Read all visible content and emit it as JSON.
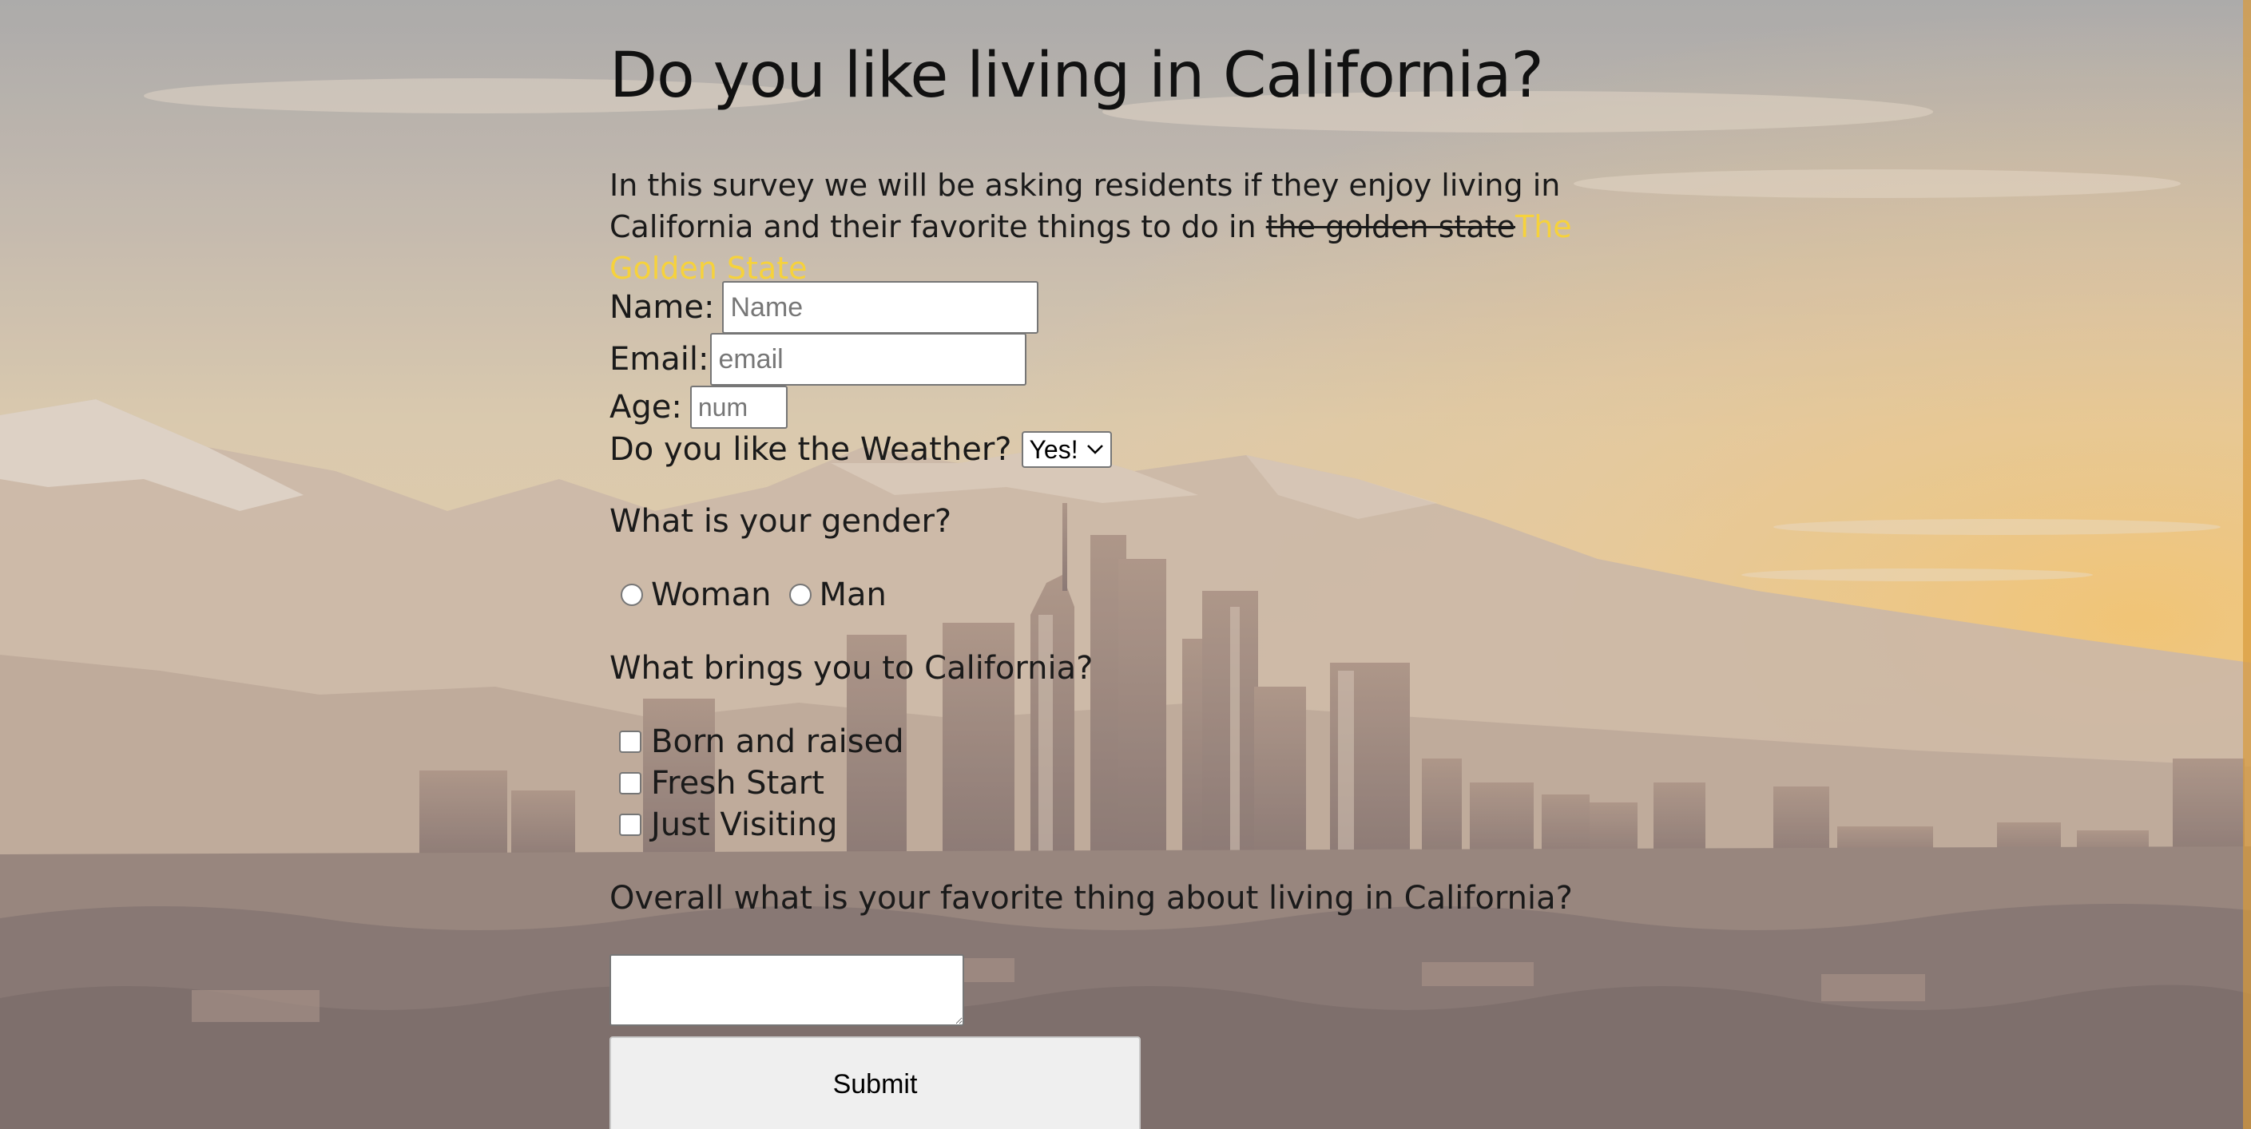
{
  "page": {
    "title": "Do you like living in California?",
    "intro": {
      "text": "In this survey we will be asking residents if they enjoy living in California and their favorite things to do in ",
      "struck": "the golden state",
      "highlight": "The Golden State"
    }
  },
  "form": {
    "name": {
      "label": "Name:",
      "placeholder": "Name"
    },
    "email": {
      "label": "Email:",
      "placeholder": "email"
    },
    "age": {
      "label": "Age:",
      "placeholder": "num"
    },
    "weather": {
      "label": "Do you like the Weather?",
      "selected": "Yes!"
    },
    "gender": {
      "question": "What is your gender?",
      "options": [
        "Woman",
        "Man"
      ]
    },
    "brings": {
      "question": "What brings you to California?",
      "options": [
        "Born and raised",
        "Fresh Start",
        "Just Visiting"
      ]
    },
    "favorite": {
      "question": "Overall what is your favorite thing about living in California?"
    },
    "submit_label": "Submit"
  },
  "colors": {
    "highlight": "#f6d23c",
    "text": "#111111",
    "sky_top": "#9fa2a6",
    "sky_glow": "#f2c36d"
  },
  "icons": {
    "select_arrow": "chevron-down-icon",
    "textarea_resize": "resize-grip-icon"
  }
}
